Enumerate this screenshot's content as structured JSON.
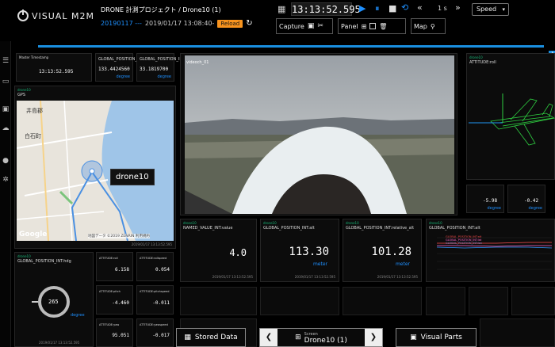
{
  "header": {
    "logo_text": "VISUAL M2M",
    "title": "DRONE 計測プロジェクト / Drone10 (1)",
    "date_code": "20190117 ---",
    "datetime": "2019/01/17 13:08:40-",
    "reload_label": "Reload",
    "clock": "13:13:52.595",
    "step": "1 s",
    "speed_label": "Speed",
    "capture_label": "Capture",
    "panel_label": "Panel",
    "map_label": "Map"
  },
  "panels": {
    "timestamp": {
      "head": "Master Timestamp",
      "value": "13:13:52.595"
    },
    "lon": {
      "label": "GLOBAL_POSITION_INT:lon",
      "value": "133.4424560",
      "unit": "degree"
    },
    "lat": {
      "label": "GLOBAL_POSITION_INT:lat",
      "value": "33.1819700",
      "unit": "degree"
    },
    "gps": {
      "head": "drone10",
      "label": "GPS",
      "callout": "drone10",
      "place1": "井島郡",
      "place2": "白石町",
      "google": "Google",
      "copyright": "地図データ ©2019 ZENRIN  利用規約",
      "ts": "2019/01/17 13:13:52.595"
    },
    "video": {
      "label": "videoch_01"
    },
    "attitude": {
      "head": "drone10",
      "label": "ATTITUDE:roll"
    },
    "small1": {
      "value": "-5.98",
      "unit": "degree"
    },
    "small2": {
      "value": "-0.42",
      "unit": "degree"
    },
    "named": {
      "head": "drone10",
      "label": "NAMED_VALUE_INT:value",
      "value": "4.0",
      "ts": "2019/01/17 13:13:52.595"
    },
    "alt": {
      "head": "drone10",
      "label": "GLOBAL_POSITION_INT:alt",
      "value": "113.30",
      "unit": "meter",
      "ts": "2019/01/17 13:13:52.595"
    },
    "relalt": {
      "head": "drone10",
      "label": "GLOBAL_POSITION_INT:relative_alt",
      "value": "101.28",
      "unit": "meter",
      "ts": "2019/01/17 13:13:52.595"
    },
    "chart": {
      "head": "drone10",
      "label": "GLOBAL_POSITION_INT:alt",
      "series": [
        "GLOBAL_POSITION_INT:alt",
        "GLOBAL_POSITION_INT:lat",
        "GLOBAL_POSITION_INT:lon"
      ]
    },
    "hdg": {
      "head": "drone10",
      "label": "GLOBAL_POSITION_INT:hdg",
      "value": "265",
      "unit": "degree",
      "ts": "2019/01/17 13:13:52.595"
    },
    "m1": {
      "label": "ATTITUDE:roll",
      "value": "6.158"
    },
    "m2": {
      "label": "ATTITUDE:rollspeed",
      "value": "0.054"
    },
    "m3": {
      "label": "ATTITUDE:pitch",
      "value": "-4.460"
    },
    "m4": {
      "label": "ATTITUDE:pitchspeed",
      "value": "-0.011"
    },
    "m5": {
      "label": "ATTITUDE:yaw",
      "value": "95.051"
    },
    "m6": {
      "label": "ATTITUDE:yawspeed",
      "value": "-0.017"
    }
  },
  "bottom": {
    "stored_label": "Stored Data",
    "screen_caption": "Screen",
    "screen_name": "Drone10 (1)",
    "visual_parts_label": "Visual Parts"
  },
  "colors": {
    "accent": "#1e90ff",
    "orange": "#f7931e",
    "green": "#17b978"
  }
}
